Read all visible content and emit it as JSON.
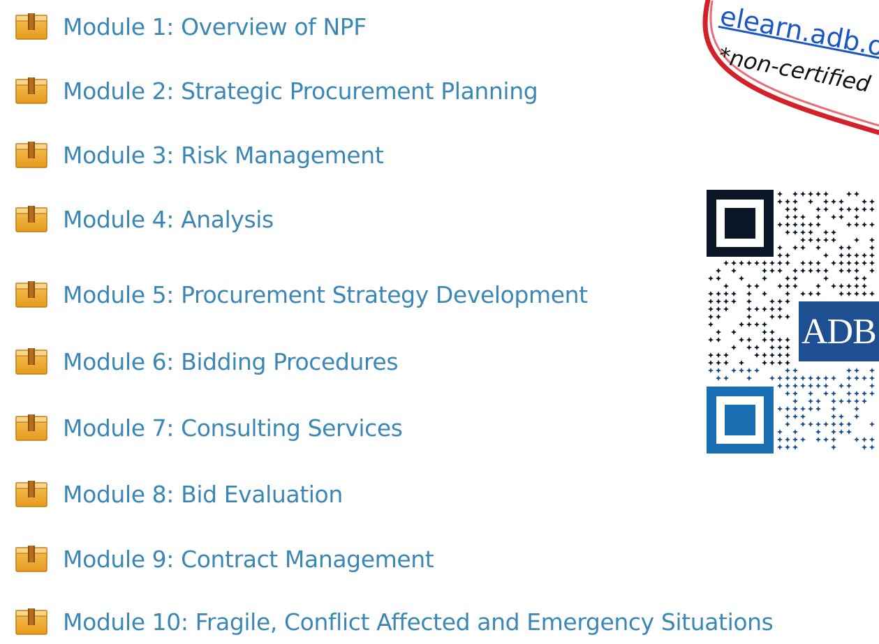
{
  "modules": [
    {
      "label": "Module 1: Overview of NPF"
    },
    {
      "label": "Module 2: Strategic Procurement Planning"
    },
    {
      "label": "Module 3: Risk Management"
    },
    {
      "label": "Module 4: Analysis"
    },
    {
      "label": "Module 5: Procurement Strategy Development"
    },
    {
      "label": "Module 6: Bidding Procedures"
    },
    {
      "label": "Module 7: Consulting Services"
    },
    {
      "label": "Module 8: Bid Evaluation"
    },
    {
      "label": "Module 9: Contract Management"
    },
    {
      "label": "Module 10: Fragile, Conflict Affected and Emergency Situations"
    }
  ],
  "callout": {
    "link_text": "elearn.adb.o",
    "note": "*non-certified"
  },
  "qr": {
    "badge_text": "ADB"
  },
  "colors": {
    "link": "#3a87b5",
    "callout_link": "#1a56c4",
    "callout_ring": "#d4202a",
    "qr_dark": "#0b1626",
    "qr_finder_blue": "#1a6fb3",
    "badge": "#1d4f91"
  },
  "icons": {
    "module": "package-icon",
    "qr": "qr-code-icon"
  }
}
